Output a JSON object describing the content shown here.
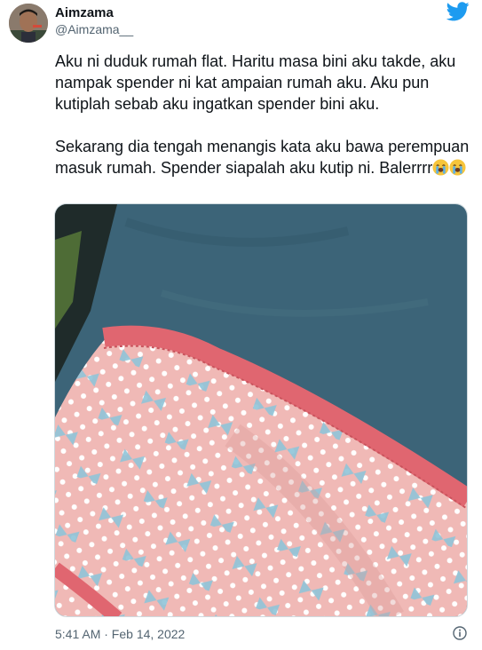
{
  "tweet": {
    "display_name": "Aimzama",
    "handle": "@Aimzama__",
    "text_part1": "Aku ni duduk rumah flat. Haritu masa bini aku takde, aku nampak spender ni kat ampaian rumah aku. Aku pun kutiplah sebab aku ingatkan spender bini aku.\n\nSekarang dia tengah menangis kata aku bawa perempuan masuk rumah. Spender siapalah aku kutip ni. Balerrrr",
    "emoji": "loudly-crying-face",
    "timestamp": "5:41 AM · Feb 14, 2022"
  },
  "icons": {
    "brand": "twitter-bird-icon",
    "info": "info-icon"
  },
  "colors": {
    "twitter_blue": "#1d9bf0",
    "text": "#0f1419",
    "muted": "#536471"
  }
}
